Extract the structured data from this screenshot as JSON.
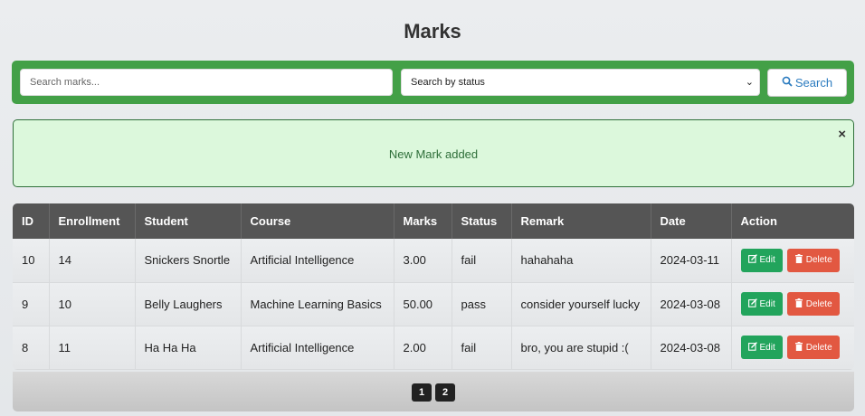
{
  "page": {
    "title": "Marks"
  },
  "search": {
    "placeholder": "Search marks...",
    "status_select": "Search by status",
    "button_label": "Search"
  },
  "alert": {
    "message": "New Mark added",
    "close": "×"
  },
  "table": {
    "headers": [
      "ID",
      "Enrollment",
      "Student",
      "Course",
      "Marks",
      "Status",
      "Remark",
      "Date",
      "Action"
    ],
    "rows": [
      {
        "id": "10",
        "enrollment": "14",
        "student": "Snickers Snortle",
        "course": "Artificial Intelligence",
        "marks": "3.00",
        "status": "fail",
        "remark": "hahahaha",
        "date": "2024-03-11"
      },
      {
        "id": "9",
        "enrollment": "10",
        "student": "Belly Laughers",
        "course": "Machine Learning Basics",
        "marks": "50.00",
        "status": "pass",
        "remark": "consider yourself lucky",
        "date": "2024-03-08"
      },
      {
        "id": "8",
        "enrollment": "11",
        "student": "Ha Ha Ha",
        "course": "Artificial Intelligence",
        "marks": "2.00",
        "status": "fail",
        "remark": "bro, you are stupid :(",
        "date": "2024-03-08"
      }
    ],
    "edit_label": "Edit",
    "delete_label": "Delete"
  },
  "pagination": {
    "pages": [
      "1",
      "2"
    ]
  },
  "colors": {
    "accent_green": "#43a047",
    "edit_green": "#22a45c",
    "delete_red": "#e25841",
    "header_gray": "#555555",
    "link_blue": "#2b7bbf"
  }
}
